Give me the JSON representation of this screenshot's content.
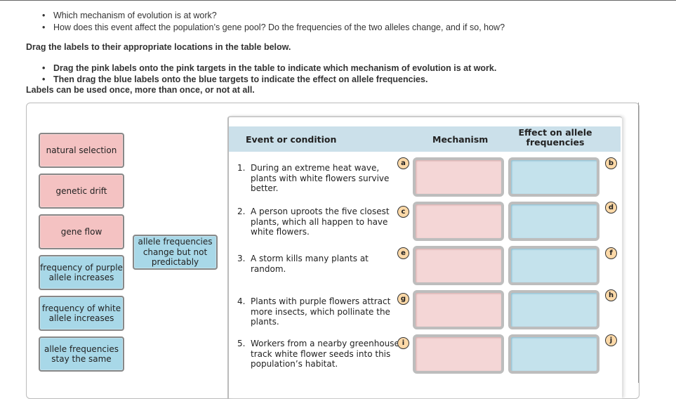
{
  "questions": [
    "Which mechanism of evolution is at work?",
    "How does this event affect the population’s gene pool? Do the frequencies of the two alleles change, and if so, how?"
  ],
  "instruction": "Drag the labels to their appropriate locations in the table below.",
  "steps": [
    "Drag the pink labels onto the pink targets in the table to indicate which mechanism of evolution is at work.",
    "Then drag the blue labels onto the blue targets to indicate the effect on allele frequencies."
  ],
  "note": "Labels can be used once, more than once, or not at all.",
  "labels": {
    "pink": [
      "natural selection",
      "genetic drift",
      "gene flow"
    ],
    "blue": [
      "frequency of purple allele increases",
      "frequency of white allele increases",
      "allele frequencies stay the same",
      "allele frequencies change but not predictably"
    ]
  },
  "colors": {
    "pink_label": "#f4c2c2",
    "blue_label": "#a8d8e8",
    "header_bg": "#cbe0ea",
    "badge": "#fcd9a8"
  },
  "table": {
    "headers": [
      "Event or condition",
      "Mechanism",
      "Effect on allele frequencies"
    ],
    "rows": [
      {
        "num": "1.",
        "text": "During an extreme heat wave, plants with white flowers survive better.",
        "mech_badge": "a",
        "effect_badge": "b"
      },
      {
        "num": "2.",
        "text": "A person uproots the five closest plants, which all happen to have white flowers.",
        "mech_badge": "c",
        "effect_badge": "d"
      },
      {
        "num": "3.",
        "text": "A storm kills many plants at random.",
        "mech_badge": "e",
        "effect_badge": "f"
      },
      {
        "num": "4.",
        "text": "Plants with purple flowers attract more insects, which pollinate the plants.",
        "mech_badge": "g",
        "effect_badge": "h"
      },
      {
        "num": "5.",
        "text": "Workers from a nearby greenhouse track white flower seeds into this population’s habitat.",
        "mech_badge": "i",
        "effect_badge": "j"
      }
    ]
  }
}
